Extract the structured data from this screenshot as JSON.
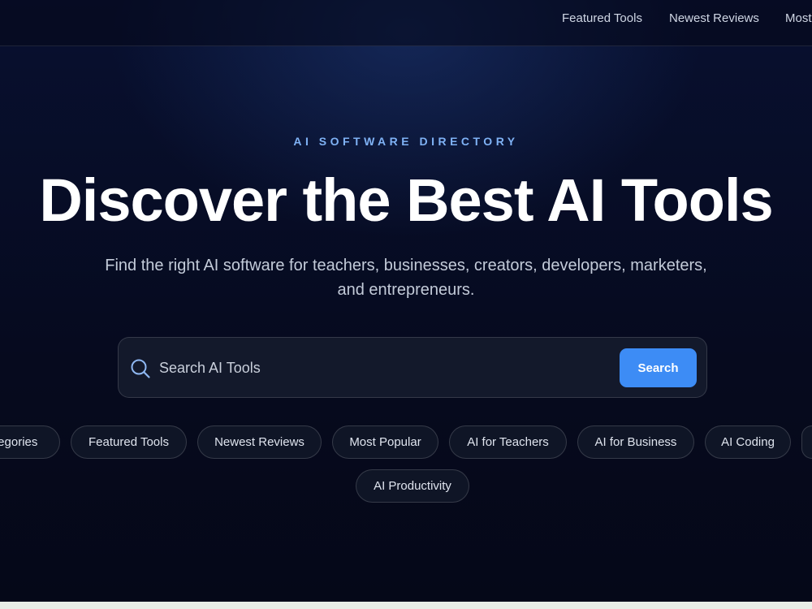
{
  "nav": {
    "links": [
      "Featured Tools",
      "Newest Reviews",
      "Most"
    ]
  },
  "hero": {
    "eyebrow": "AI SOFTWARE DIRECTORY",
    "title": "Discover the Best AI Tools",
    "subtitle": "Find the right AI software for teachers, businesses, creators, developers, marketers, and entrepreneurs."
  },
  "search": {
    "placeholder": "Search AI Tools",
    "value": "",
    "button_label": "Search"
  },
  "chips": [
    "tegories",
    "Featured Tools",
    "Newest Reviews",
    "Most Popular",
    "AI for Teachers",
    "AI for Business",
    "AI Coding",
    "AI Productivity"
  ],
  "colors": {
    "background": "#070b1f",
    "accent": "#3d8cf5",
    "eyebrow": "#7fb2f5"
  }
}
